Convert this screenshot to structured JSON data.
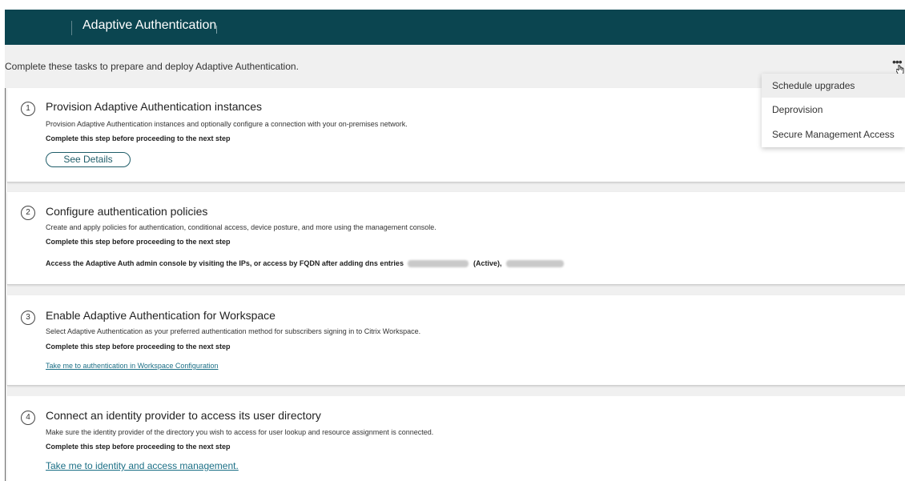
{
  "header": {
    "title": "Adaptive Authentication"
  },
  "intro_text": "Complete these tasks to prepare and deploy Adaptive Authentication.",
  "more_menu": {
    "icon": "more-dots-icon",
    "items": [
      {
        "label": "Schedule upgrades",
        "highlighted": true
      },
      {
        "label": "Deprovision"
      },
      {
        "label": "Secure Management Access"
      }
    ]
  },
  "steps": [
    {
      "number": "1",
      "title": "Provision Adaptive Authentication instances",
      "description": "Provision Adaptive Authentication instances and optionally configure a connection with your on-premises network.",
      "requirement": "Complete this step before proceeding to the next step",
      "button_label": "See Details"
    },
    {
      "number": "2",
      "title": "Configure authentication policies",
      "description": "Create and apply policies for authentication, conditional access, device posture, and more using the management console.",
      "requirement": "Complete this step before proceeding to the next step",
      "access_text": "Access the Adaptive Auth admin console by visiting the IPs, or access by FQDN after adding dns entries",
      "active_text": "(Active),"
    },
    {
      "number": "3",
      "title": "Enable Adaptive Authentication for Workspace",
      "description": "Select Adaptive Authentication as your preferred authentication method for subscribers signing in to Citrix Workspace.",
      "requirement": "Complete this step before proceeding to the next step",
      "link_label": "Take me to authentication in Workspace Configuration"
    },
    {
      "number": "4",
      "title": "Connect an identity provider to access its user directory",
      "description": "Make sure the identity provider of the directory you wish to access for user lookup and resource assignment is connected.",
      "requirement": "Complete this step before proceeding to the next step",
      "link_label": "Take me to identity and access management."
    }
  ],
  "colors": {
    "header_bg": "#0b4550",
    "link": "#1b6f86",
    "button_border": "#1f5d69",
    "page_bg": "#f0f0f0"
  }
}
